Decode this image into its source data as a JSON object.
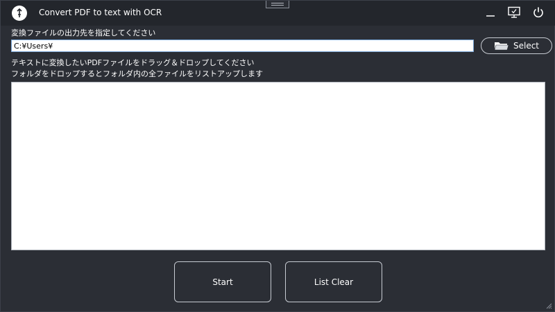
{
  "window": {
    "title": "Convert PDF to text with OCR"
  },
  "titlebar_icons": [
    "app-logo-icon",
    "minimize-icon",
    "monitor-check-icon",
    "power-icon"
  ],
  "output": {
    "label": "変換ファイルの出力先を指定してください",
    "path_value": "C:¥Users¥",
    "select_label": "Select"
  },
  "instructions": {
    "line1": "テキストに変換したいPDFファイルをドラッグ＆ドロップしてください",
    "line2": "フォルダをドロップするとフォルダ内の全ファイルをリストアップします"
  },
  "actions": {
    "start_label": "Start",
    "clear_label": "List Clear"
  },
  "colors": {
    "background": "#2b2e35",
    "titlebar": "#23262c",
    "list_background": "#ffffff",
    "input_border": "#7aa7d8"
  }
}
